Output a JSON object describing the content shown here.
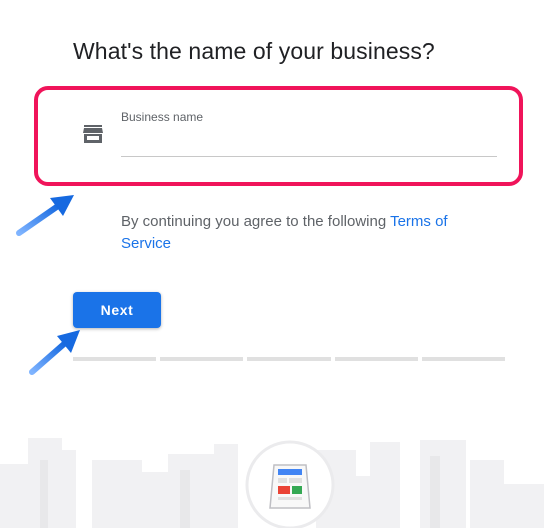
{
  "page": {
    "heading": "What's the name of your business?"
  },
  "business_field": {
    "label": "Business name",
    "value": "",
    "icon": "store-icon"
  },
  "terms": {
    "prefix": "By continuing you agree to the following ",
    "link_text": "Terms of Service"
  },
  "next_button": {
    "label": "Next"
  },
  "progress": {
    "step": 1,
    "total_steps": 5
  },
  "colors": {
    "accent": "#1a73e8",
    "highlight": "#f0145a",
    "annotation_arrow": "#2a7fe0"
  }
}
